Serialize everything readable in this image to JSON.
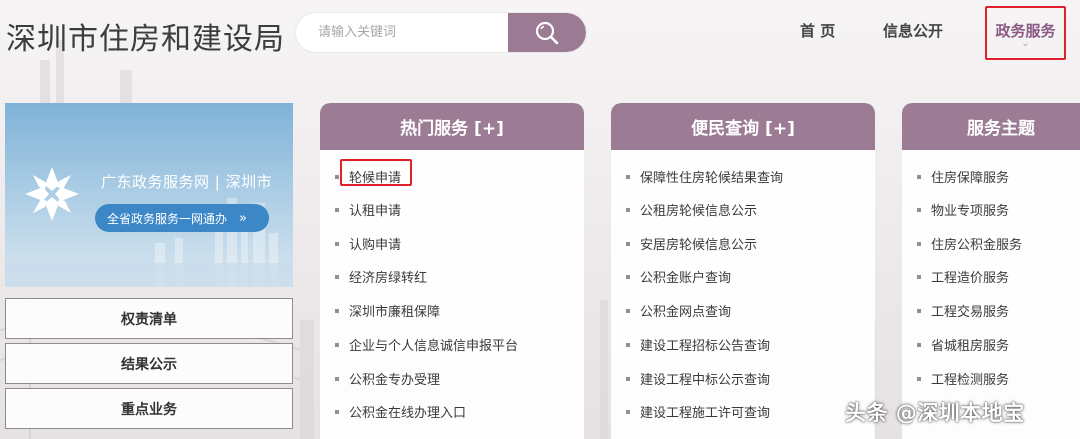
{
  "header": {
    "site_title": "深圳市住房和建设局",
    "search_placeholder": "请输入关键词",
    "nav": [
      "首 页",
      "信息公开"
    ],
    "nav_active": "政务服务"
  },
  "banner": {
    "title": "广东政务服务网 | 深圳市",
    "button_label": "全省政务服务一网通办",
    "button_arrow": "»"
  },
  "side_buttons": [
    "权责清单",
    "结果公示",
    "重点业务"
  ],
  "panels": [
    {
      "title": "热门服务 [+]",
      "items": [
        "轮候申请",
        "认租申请",
        "认购申请",
        "经济房绿转红",
        "深圳市廉租保障",
        "企业与个人信息诚信申报平台",
        "公积金专办受理",
        "公积金在线办理入口"
      ]
    },
    {
      "title": "便民查询 [+]",
      "items": [
        "保障性住房轮候结果查询",
        "公租房轮候信息公示",
        "安居房轮候信息公示",
        "公积金账户查询",
        "公积金网点查询",
        "建设工程招标公告查询",
        "建设工程中标公示查询",
        "建设工程施工许可查询"
      ]
    },
    {
      "title": "服务主题",
      "items": [
        "住房保障服务",
        "物业专项服务",
        "住房公积金服务",
        "工程造价服务",
        "工程交易服务",
        "省城租房服务",
        "工程检测服务"
      ]
    }
  ],
  "watermark": "头条 @深圳本地宝",
  "colors": {
    "accent": "#9c7c95",
    "highlight": "#e0202a"
  }
}
